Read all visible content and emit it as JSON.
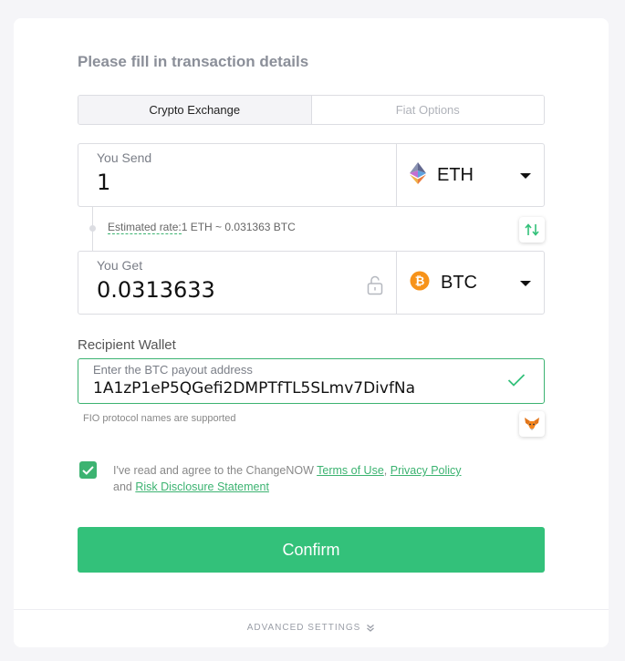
{
  "page": {
    "title": "Please fill in transaction details"
  },
  "tabs": [
    {
      "label": "Crypto Exchange",
      "active": true
    },
    {
      "label": "Fiat Options",
      "active": false
    }
  ],
  "send": {
    "label": "You Send",
    "amount": "1",
    "currency": "ETH",
    "icon": "ethereum-icon"
  },
  "rate": {
    "label": "Estimated rate:",
    "value": "1 ETH ~ 0.031363 BTC"
  },
  "get": {
    "label": "You Get",
    "amount": "0.0313633",
    "currency": "BTC",
    "icon": "bitcoin-icon"
  },
  "recipient": {
    "label": "Recipient Wallet",
    "placeholder": "Enter the BTC payout address",
    "value": "1A1zP1eP5QGefi2DMPTfTL5SLmv7DivfNa"
  },
  "fio_note": "FIO protocol names are supported",
  "agreement": {
    "prefix": "I've read and agree to the ChangeNOW ",
    "terms": "Terms of Use",
    "comma": ",",
    "privacy": "Privacy Policy",
    "and": "and ",
    "risk": "Risk Disclosure Statement"
  },
  "confirm_label": "Confirm",
  "advanced_label": "ADVANCED SETTINGS",
  "colors": {
    "accent": "#33c17a",
    "bitcoin": "#f7931a"
  }
}
